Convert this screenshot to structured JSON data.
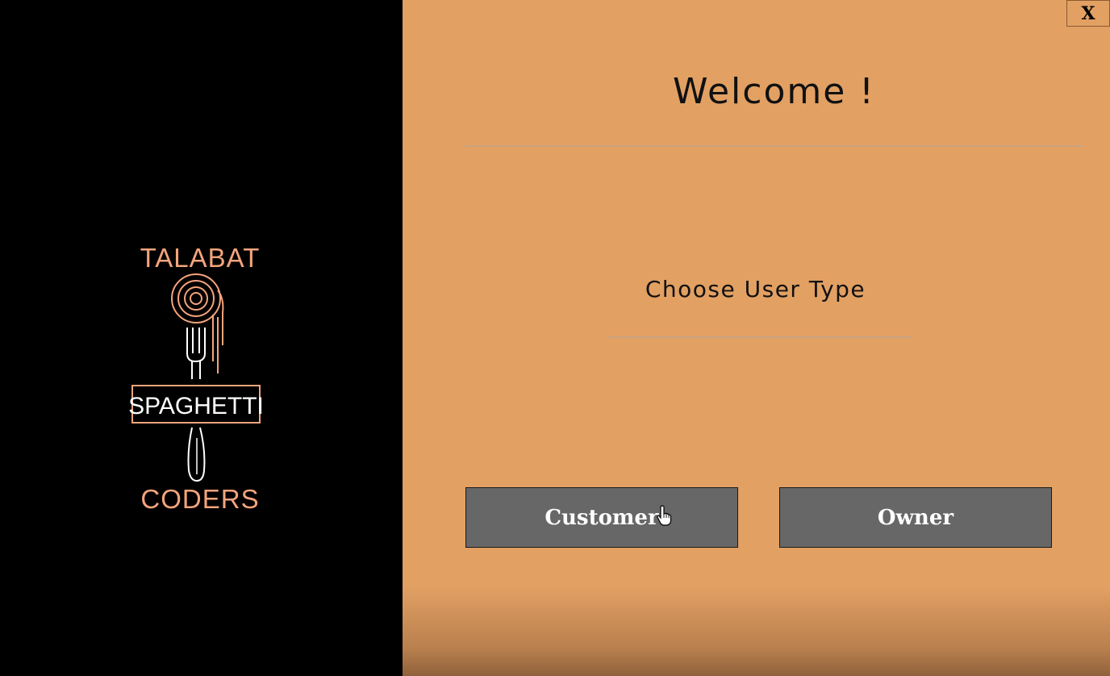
{
  "window": {
    "close_label": "X"
  },
  "logo": {
    "line_top": "TALABAT",
    "line_middle": "SPAGHETTI",
    "line_bottom": "CODERS",
    "colors": {
      "accent": "#f4a47c",
      "white": "#ffffff"
    }
  },
  "main": {
    "title": "Welcome !",
    "subtitle": "Choose User Type",
    "buttons": {
      "customer_label": "Customer",
      "owner_label": "Owner"
    }
  },
  "theme": {
    "left_background": "#000000",
    "right_background": "#e2a063",
    "button_background": "#676767",
    "button_text": "#ffffff"
  }
}
